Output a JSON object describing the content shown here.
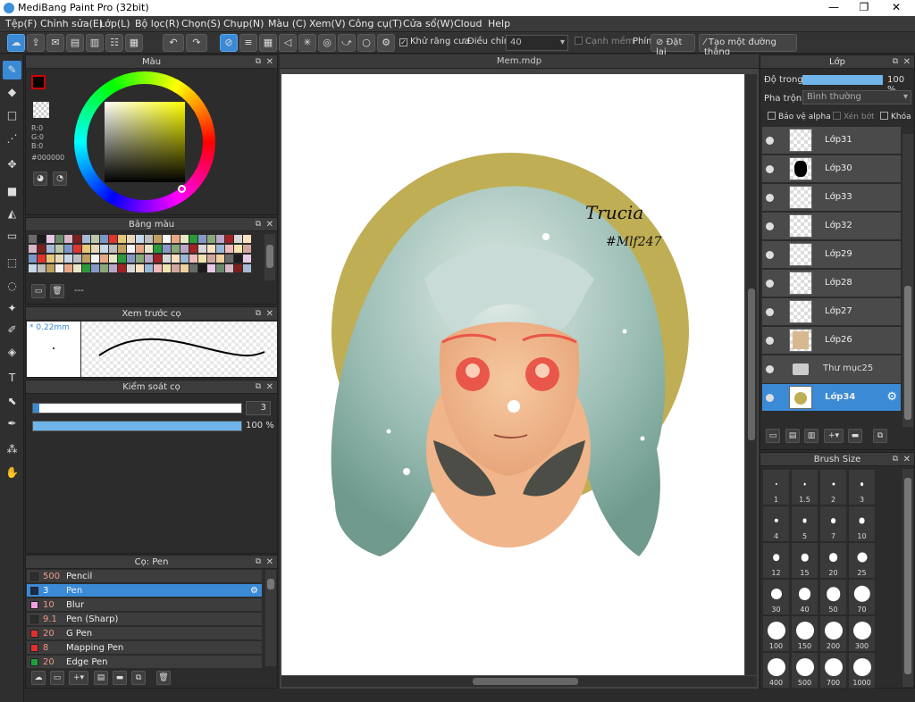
{
  "app": {
    "title": "MediBang Paint Pro (32bit)",
    "min": "—",
    "max": "❐",
    "close": "✕"
  },
  "menu": [
    "Tệp(F)",
    "Chỉnh sửa(E)",
    "Lớp(L)",
    "Bộ lọc(R)",
    "Chọn(S)",
    "Chụp(N)",
    "Màu (C)",
    "Xem(V)",
    "Công cụ(T)",
    "Cửa sổ(W)",
    "Cloud",
    "Help"
  ],
  "toolbar": {
    "antialias": "Khử răng cưa",
    "adjust_label": "Điều chỉnh",
    "adjust_value": "40",
    "soft_edge": "Cạnh mềm",
    "key_label": "Phím",
    "reset": "Đặt lại",
    "make_line": "Tạo một đường thẳng"
  },
  "color_panel": {
    "title": "Màu",
    "r": "R:0",
    "g": "G:0",
    "b": "B:0",
    "hex": "#000000"
  },
  "palette_panel": {
    "title": "Bảng màu",
    "dash": "---"
  },
  "brush_preview": {
    "title": "Xem trước cọ",
    "size": "0.22mm"
  },
  "brush_control": {
    "title": "Kiểm soát cọ",
    "size_value": "3",
    "opacity": "100 %",
    "size_fraction": 0.03,
    "opacity_fraction": 1.0
  },
  "brush_list": {
    "title": "Cọ: Pen",
    "items": [
      {
        "size": "500",
        "name": "Pencil",
        "color": "#2e2e2e"
      },
      {
        "size": "3",
        "name": "Pen",
        "color": "#1d2b4a",
        "selected": true
      },
      {
        "size": "10",
        "name": "Blur",
        "color": "#f0a0e0"
      },
      {
        "size": "9.1",
        "name": "Pen (Sharp)",
        "color": "#2e2e2e"
      },
      {
        "size": "20",
        "name": "G Pen",
        "color": "#e03030"
      },
      {
        "size": "8",
        "name": "Mapping Pen",
        "color": "#e03030"
      },
      {
        "size": "20",
        "name": "Edge Pen",
        "color": "#20a040"
      }
    ]
  },
  "document": {
    "tab": "Mem.mdp",
    "signature": "Trucia",
    "signature2": "#Mlf247"
  },
  "layer_panel": {
    "title": "Lớp",
    "opacity_label": "Độ trong",
    "opacity_value": "100 %",
    "blend_label": "Pha trộn",
    "blend_value": "Bình thường",
    "protect_alpha": "Bảo vệ alpha",
    "clip": "Xén bớt",
    "lock": "Khóa",
    "layers": [
      {
        "name": "Lớp31"
      },
      {
        "name": "Lớp30"
      },
      {
        "name": "Lớp33"
      },
      {
        "name": "Lớp32"
      },
      {
        "name": "Lớp29"
      },
      {
        "name": "Lớp28"
      },
      {
        "name": "Lớp27"
      },
      {
        "name": "Lớp26"
      }
    ],
    "folder": "Thư mục25",
    "selected_layer": "Lớp34"
  },
  "brush_size_panel": {
    "title": "Brush Size",
    "sizes": [
      "1",
      "1.5",
      "2",
      "3",
      "4",
      "5",
      "7",
      "10",
      "12",
      "15",
      "20",
      "25",
      "30",
      "40",
      "50",
      "70",
      "100",
      "150",
      "200",
      "300",
      "400",
      "500",
      "700",
      "1000"
    ]
  },
  "colors": {
    "accent": "#3a8ad6",
    "circle": "#bfae54",
    "hair": "#8fb5ac"
  }
}
